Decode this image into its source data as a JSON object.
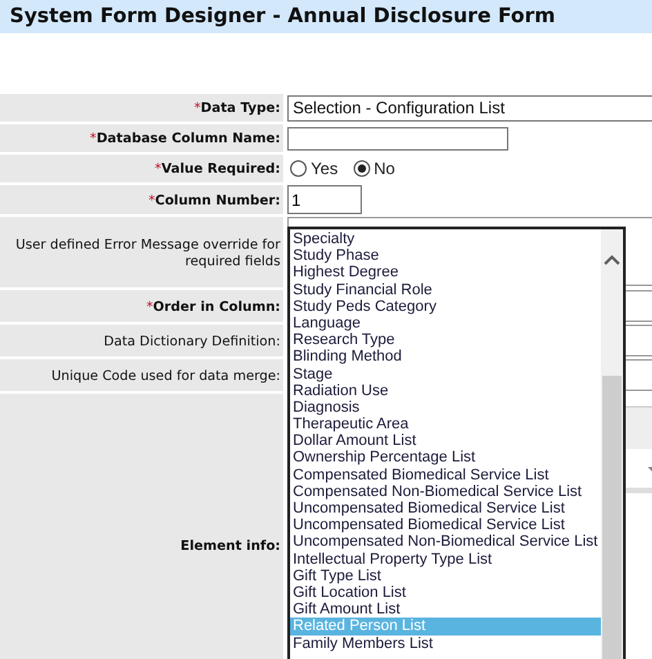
{
  "window": {
    "title": "System Form Designer - Annual Disclosure Form"
  },
  "form": {
    "rows": [
      {
        "label": "Data Type:",
        "marker": "*",
        "emphasis": true,
        "kind": "select",
        "value": "Selection - Configuration List"
      },
      {
        "label": "Database Column Name:",
        "marker": "*",
        "emphasis": true,
        "kind": "text",
        "value": ""
      },
      {
        "label": "Value Required:",
        "marker": "*",
        "emphasis": true,
        "kind": "radio",
        "options": [
          {
            "label": "Yes",
            "selected": false
          },
          {
            "label": "No",
            "selected": true
          }
        ]
      },
      {
        "label": "Column Number:",
        "marker": "*",
        "emphasis": true,
        "kind": "short",
        "value": "1"
      },
      {
        "label": "User defined Error Message override for required fields",
        "emphasis": false,
        "kind": "area"
      },
      {
        "label": "Order in Column:",
        "marker": "*",
        "emphasis": true,
        "kind": "wide"
      },
      {
        "label": "Data Dictionary Definition:",
        "emphasis": false,
        "kind": "wide"
      },
      {
        "label": "Unique Code used for data merge:",
        "emphasis": false,
        "kind": "wide"
      },
      {
        "label": "Element info:",
        "emphasis": true,
        "kind": "info"
      }
    ]
  },
  "listbox": {
    "items": [
      {
        "label": "Specialty",
        "selected": false
      },
      {
        "label": "Study Phase",
        "selected": false
      },
      {
        "label": "Highest Degree",
        "selected": false
      },
      {
        "label": "Study Financial Role",
        "selected": false
      },
      {
        "label": "Study Peds Category",
        "selected": false
      },
      {
        "label": "Language",
        "selected": false
      },
      {
        "label": "Research Type",
        "selected": false
      },
      {
        "label": "Blinding Method",
        "selected": false
      },
      {
        "label": "Stage",
        "selected": false
      },
      {
        "label": "Radiation Use",
        "selected": false
      },
      {
        "label": "Diagnosis",
        "selected": false
      },
      {
        "label": "Therapeutic Area",
        "selected": false
      },
      {
        "label": "Dollar Amount List",
        "selected": false
      },
      {
        "label": "Ownership Percentage List",
        "selected": false
      },
      {
        "label": "Compensated Biomedical Service List",
        "selected": false
      },
      {
        "label": "Compensated Non-Biomedical Service List",
        "selected": false
      },
      {
        "label": "Uncompensated Biomedical Service List",
        "selected": false
      },
      {
        "label": "Uncompensated Biomedical Service List",
        "selected": false
      },
      {
        "label": "Uncompensated Non-Biomedical Service List",
        "selected": false
      },
      {
        "label": "Intellectual Property Type List",
        "selected": false
      },
      {
        "label": "Gift Type List",
        "selected": false
      },
      {
        "label": "Gift Location List",
        "selected": false
      },
      {
        "label": "Gift Amount List",
        "selected": false
      },
      {
        "label": "Related Person List",
        "selected": true
      },
      {
        "label": "Family Members List",
        "selected": false
      }
    ]
  }
}
